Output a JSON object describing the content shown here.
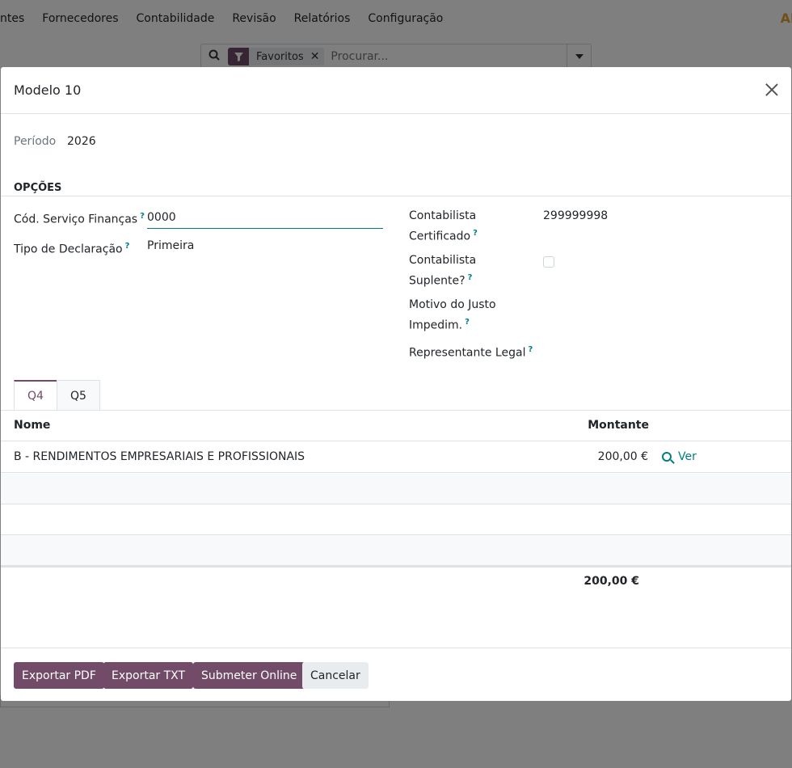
{
  "nav": {
    "items": [
      "ntes",
      "Fornecedores",
      "Contabilidade",
      "Revisão",
      "Relatórios",
      "Configuração"
    ]
  },
  "search": {
    "facet_label": "Favoritos",
    "placeholder": "Procurar..."
  },
  "modal": {
    "title": "Modelo 10",
    "periodo_label": "Período",
    "periodo_value": "2026",
    "section_title": "OPÇÕES",
    "cod_servico_label": "Cód. Serviço Finanças",
    "cod_servico_value": "0000",
    "tipo_declaracao_label": "Tipo de Declaração",
    "tipo_declaracao_value": "Primeira",
    "contabilista_line1": "Contabilista",
    "contabilista_line2": "Certificado",
    "contabilista_value": "299999998",
    "suplente_line1": "Contabilista",
    "suplente_line2": "Suplente?",
    "motivo_line1": "Motivo do Justo",
    "motivo_line2": "Impedim.",
    "representante_label": "Representante Legal",
    "help_mark": "?"
  },
  "tabs": [
    "Q4",
    "Q5"
  ],
  "table": {
    "col_nome": "Nome",
    "col_montante": "Montante",
    "rows": [
      {
        "nome": "B - RENDIMENTOS EMPRESARIAIS E PROFISSIONAIS",
        "montante": "200,00 €",
        "action": "Ver"
      }
    ],
    "total": "200,00 €"
  },
  "footer": {
    "export_pdf": "Exportar PDF",
    "export_txt": "Exportar TXT",
    "submit_online": "Submeter Online",
    "cancel": "Cancelar"
  },
  "colors": {
    "primary": "#714b67",
    "link": "#017e84"
  }
}
